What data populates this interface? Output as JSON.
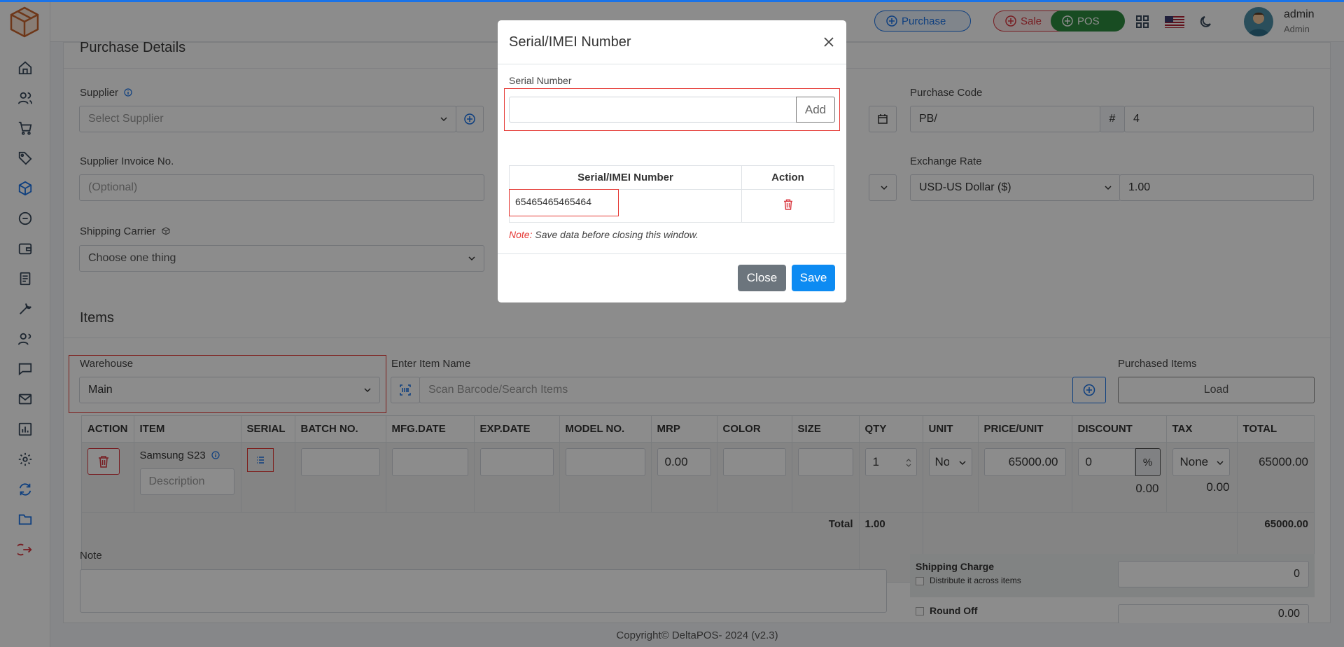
{
  "header": {
    "purchase_label": "Purchase",
    "sale_label": "Sale",
    "pos_label": "POS",
    "user_name": "admin",
    "user_role": "Admin"
  },
  "purchase_details": {
    "title": "Purchase Details",
    "supplier_label": "Supplier",
    "supplier_placeholder": "Select Supplier",
    "purchase_code_label": "Purchase Code",
    "purchase_code_prefix": "PB/",
    "purchase_code_hash": "#",
    "purchase_code_number": "4",
    "invoice_label": "Supplier Invoice No.",
    "invoice_placeholder": "(Optional)",
    "exchange_rate_label": "Exchange Rate",
    "currency": "USD-US Dollar ($)",
    "exchange_rate": "1.00",
    "carrier_label": "Shipping Carrier",
    "carrier_placeholder": "Choose one thing"
  },
  "items_section": {
    "title": "Items",
    "warehouse_label": "Warehouse",
    "warehouse_value": "Main",
    "item_name_label": "Enter Item Name",
    "search_placeholder": "Scan Barcode/Search Items",
    "purchased_items_label": "Purchased Items",
    "load_label": "Load",
    "columns": [
      "ACTION",
      "ITEM",
      "SERIAL",
      "BATCH NO.",
      "MFG.DATE",
      "EXP.DATE",
      "MODEL NO.",
      "MRP",
      "COLOR",
      "SIZE",
      "QTY",
      "UNIT",
      "PRICE/UNIT",
      "DISCOUNT",
      "TAX",
      "TOTAL"
    ],
    "row": {
      "item_name": "Samsung S23",
      "description_placeholder": "Description",
      "mrp": "0.00",
      "qty": "1",
      "unit": "No",
      "price": "65000.00",
      "discount": "0",
      "discount_type": "%",
      "discount_amount": "0.00",
      "tax": "None",
      "tax_amount": "0.00",
      "total": "65000.00"
    },
    "total_label": "Total",
    "total_qty": "1.00",
    "grand_total": "65000.00"
  },
  "bottom": {
    "note_label": "Note",
    "shipping_charge_label": "Shipping Charge",
    "shipping_charge_value": "0",
    "distribute_label": "Distribute it across items",
    "round_off_label": "Round Off",
    "round_off_value": "0.00"
  },
  "modal": {
    "title": "Serial/IMEI Number",
    "serial_label": "Serial Number",
    "add_label": "Add",
    "col_serial": "Serial/IMEI Number",
    "col_action": "Action",
    "serials": [
      "65465465465464"
    ],
    "note_prefix": "Note:",
    "note_text": "Save data before closing this window.",
    "close_label": "Close",
    "save_label": "Save"
  },
  "footer": {
    "copyright": "Copyright© DeltaPOS- 2024 (v2.3)"
  },
  "colors": {
    "primary": "#1a73e8",
    "danger": "#d9363e",
    "success": "#28a745",
    "secondary": "#6c757d",
    "save": "#0d8bf2"
  },
  "icons": [
    "logo-cube-icon",
    "home-icon",
    "users-icon",
    "cart-icon",
    "tag-icon",
    "box-icon",
    "minus-circle-icon",
    "wallet-icon",
    "document-icon",
    "wrench-icon",
    "contacts-icon",
    "chat-icon",
    "mail-icon",
    "chart-icon",
    "gear-icon",
    "sync-icon",
    "folder-icon",
    "logout-icon"
  ]
}
